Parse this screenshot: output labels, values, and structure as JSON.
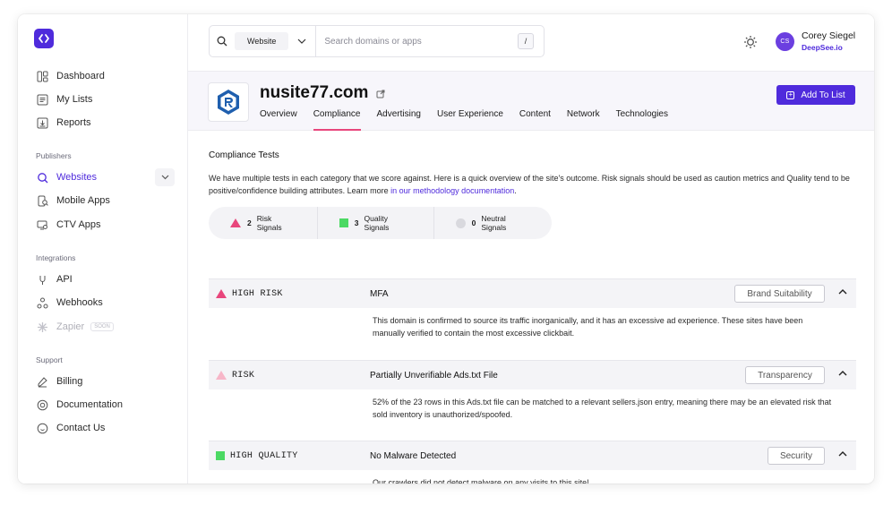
{
  "sidebar": {
    "items_top": [
      {
        "label": "Dashboard",
        "icon": "dashboard-icon"
      },
      {
        "label": "My Lists",
        "icon": "list-icon"
      },
      {
        "label": "Reports",
        "icon": "report-icon"
      }
    ],
    "publishers_label": "Publishers",
    "publishers": [
      {
        "label": "Websites",
        "icon": "globe-search-icon"
      },
      {
        "label": "Mobile Apps",
        "icon": "mobile-search-icon"
      },
      {
        "label": "CTV Apps",
        "icon": "tv-search-icon"
      }
    ],
    "integrations_label": "Integrations",
    "integrations": [
      {
        "label": "API",
        "icon": "api-icon"
      },
      {
        "label": "Webhooks",
        "icon": "webhook-icon"
      },
      {
        "label": "Zapier",
        "icon": "zapier-icon",
        "badge": "SOON"
      }
    ],
    "support_label": "Support",
    "support": [
      {
        "label": "Billing",
        "icon": "billing-icon"
      },
      {
        "label": "Documentation",
        "icon": "documentation-icon"
      },
      {
        "label": "Contact Us",
        "icon": "contact-icon"
      }
    ]
  },
  "topbar": {
    "search_type": "Website",
    "search_placeholder": "Search domains or apps",
    "shortcut": "/",
    "user_initials": "CS",
    "user_name": "Corey Siegel",
    "user_org": "DeepSee.io"
  },
  "site": {
    "name": "nusite77.com",
    "add_button": "Add To List",
    "tabs": [
      "Overview",
      "Compliance",
      "Advertising",
      "User Experience",
      "Content",
      "Network",
      "Technologies"
    ],
    "active_tab": "Compliance"
  },
  "compliance": {
    "title": "Compliance Tests",
    "description": "We have multiple tests in each category that we score against. Here is a quick overview of the site's outcome. Risk signals should be used as caution metrics and Quality tend to be positive/confidence building attributes. Learn more ",
    "link_text": "in our methodology documentation",
    "link_suffix": ".",
    "signals": [
      {
        "count": "2",
        "label": "Risk Signals"
      },
      {
        "count": "3",
        "label": "Quality Signals"
      },
      {
        "count": "0",
        "label": "Neutral Signals"
      }
    ],
    "tests": [
      {
        "level": "HIGH RISK",
        "title": "MFA",
        "category": "Brand Suitability",
        "description": "This domain is confirmed to source its traffic inorganically, and it has an excessive ad experience. These sites have been manually verified to contain the most excessive clickbait."
      },
      {
        "level": "RISK",
        "title": "Partially Unverifiable Ads.txt File",
        "category": "Transparency",
        "description": "52% of the 23 rows in this Ads.txt file can be matched to a relevant sellers.json entry, meaning there may be an elevated risk that sold inventory is unauthorized/spoofed."
      },
      {
        "level": "HIGH QUALITY",
        "title": "No Malware Detected",
        "category": "Security",
        "description": "Our crawlers did not detect malware on any visits to this site!"
      }
    ]
  },
  "colors": {
    "accent": "#4f2bdc",
    "high_risk": "#e8467c",
    "risk": "#f7b6c8",
    "quality": "#4cd964",
    "neutral": "#d9d9de"
  }
}
